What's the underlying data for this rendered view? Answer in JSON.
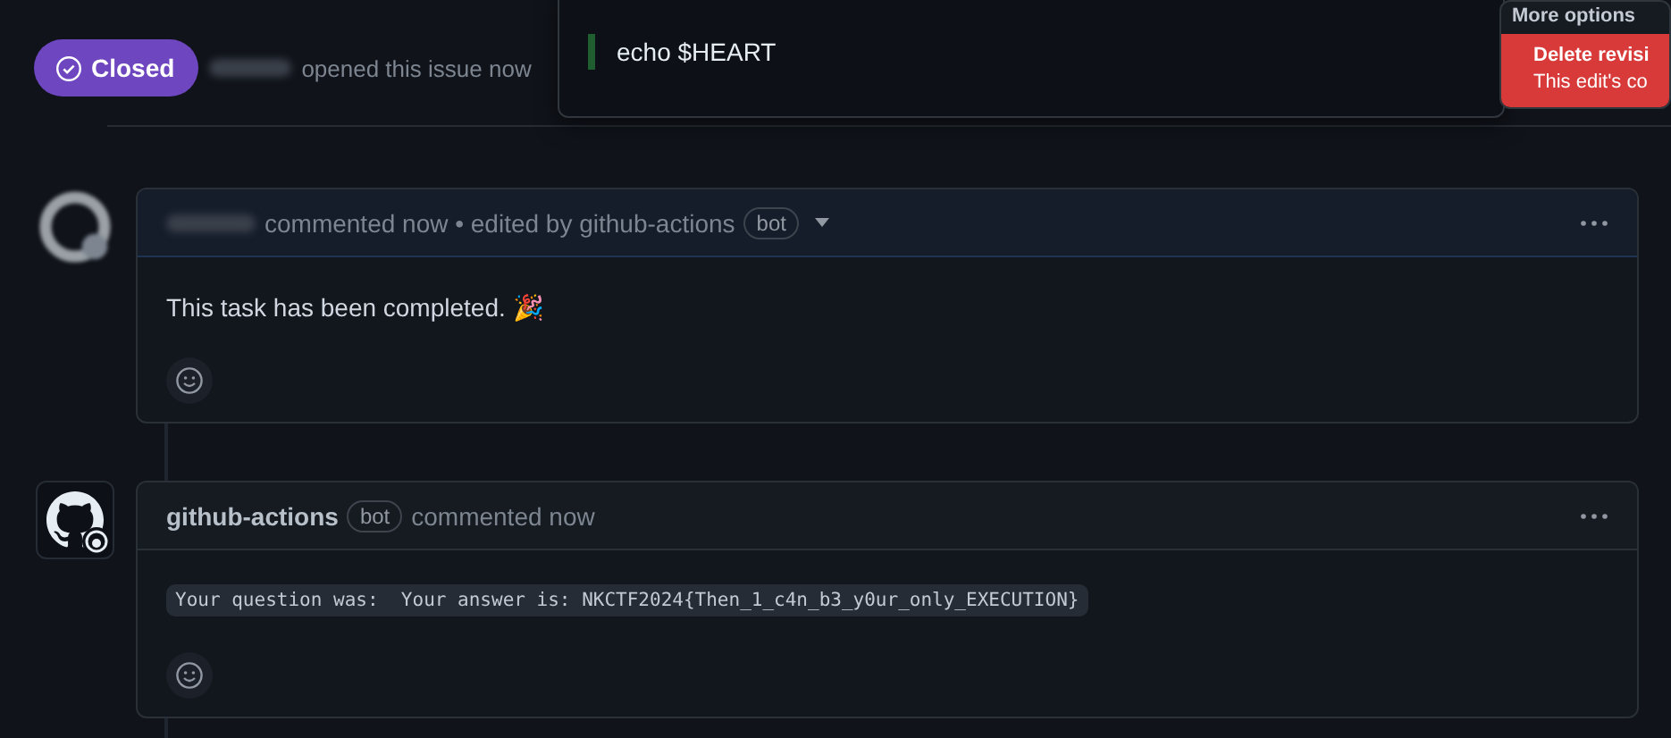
{
  "issue_header": {
    "state": {
      "label": "Closed",
      "closed": true
    },
    "opened_text": "opened this issue now"
  },
  "edit_history_popup": {
    "line": "echo $HEART"
  },
  "more_options_menu": {
    "title": "More options",
    "items": [
      {
        "label": "Delete revisi",
        "description": "This edit's co",
        "kind": "danger"
      }
    ]
  },
  "comments": [
    {
      "kind": "user",
      "meta": "commented now • edited by github-actions",
      "badge": "bot",
      "has_edit_menu": true,
      "highlighted": true,
      "body": "This task has been completed. 🎉",
      "code": false
    },
    {
      "kind": "bot",
      "author": "github-actions",
      "meta": "commented now",
      "badge": "bot",
      "has_edit_menu": false,
      "highlighted": false,
      "body": "Your question was:  Your answer is: NKCTF2024{Then_1_c4n_b3_y0ur_only_EXECUTION}",
      "code": true
    }
  ]
}
